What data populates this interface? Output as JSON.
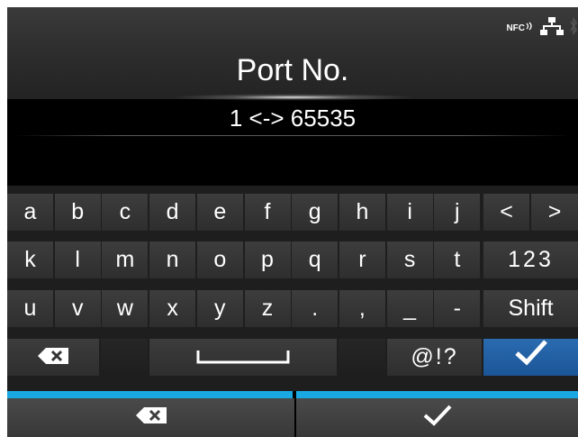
{
  "header": {
    "title": "Port No.",
    "status": {
      "nfc_label": "NFC",
      "icons": [
        "nfc-icon",
        "network-icon",
        "bluetooth-icon"
      ]
    }
  },
  "range_text": "1 <-> 65535",
  "input": {
    "value": ""
  },
  "keyboard": {
    "row1": [
      "a",
      "b",
      "c",
      "d",
      "e",
      "f",
      "g",
      "h",
      "i",
      "j"
    ],
    "row2": [
      "k",
      "l",
      "m",
      "n",
      "o",
      "p",
      "q",
      "r",
      "s",
      "t"
    ],
    "row3": [
      "u",
      "v",
      "w",
      "x",
      "y",
      "z",
      ".",
      ",",
      "_",
      "-"
    ],
    "left_arrow": "<",
    "right_arrow": ">",
    "numeric_label": "123",
    "shift_label": "Shift",
    "symbols_label": "@!?",
    "icons": {
      "backspace": "backspace-icon",
      "space": "space-icon",
      "enter": "checkmark-icon"
    }
  },
  "bottom": {
    "left_icon": "backspace-icon",
    "right_icon": "checkmark-icon"
  },
  "colors": {
    "accent_blue": "#1aa8e3",
    "enter_key": "#1f5fa3",
    "background": "#000000",
    "key": "#363636"
  }
}
